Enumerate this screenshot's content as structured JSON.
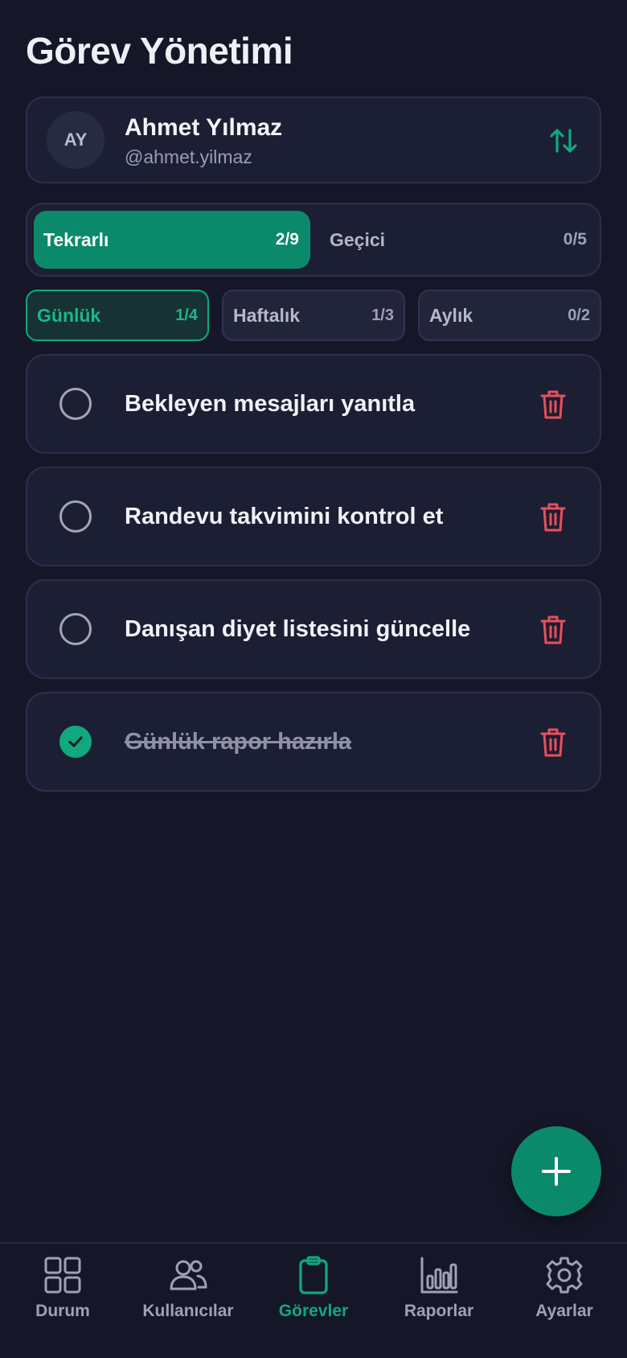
{
  "header": {
    "title": "Görev Yönetimi"
  },
  "user": {
    "initials": "AY",
    "name": "Ahmet Yılmaz",
    "handle": "@ahmet.yilmaz"
  },
  "type_tabs": [
    {
      "label": "Tekrarlı",
      "count": "2/9",
      "active": true
    },
    {
      "label": "Geçici",
      "count": "0/5",
      "active": false
    }
  ],
  "period_tabs": [
    {
      "label": "Günlük",
      "count": "1/4",
      "active": true
    },
    {
      "label": "Haftalık",
      "count": "1/3",
      "active": false
    },
    {
      "label": "Aylık",
      "count": "0/2",
      "active": false
    }
  ],
  "tasks": [
    {
      "label": "Bekleyen mesajları yanıtla",
      "done": false
    },
    {
      "label": "Randevu takvimini kontrol et",
      "done": false
    },
    {
      "label": "Danışan diyet listesini güncelle",
      "done": false
    },
    {
      "label": "Günlük rapor hazırla",
      "done": true
    }
  ],
  "bottom_nav": [
    {
      "label": "Durum",
      "icon": "grid-icon",
      "active": false
    },
    {
      "label": "Kullanıcılar",
      "icon": "users-icon",
      "active": false
    },
    {
      "label": "Görevler",
      "icon": "clipboard-icon",
      "active": true
    },
    {
      "label": "Raporlar",
      "icon": "bar-chart-icon",
      "active": false
    },
    {
      "label": "Ayarlar",
      "icon": "gear-icon",
      "active": false
    }
  ],
  "colors": {
    "background": "#151729",
    "card": "#1c1e33",
    "accent": "#0a8a6a",
    "accent_text": "#10a97e",
    "danger": "#e8505b"
  }
}
